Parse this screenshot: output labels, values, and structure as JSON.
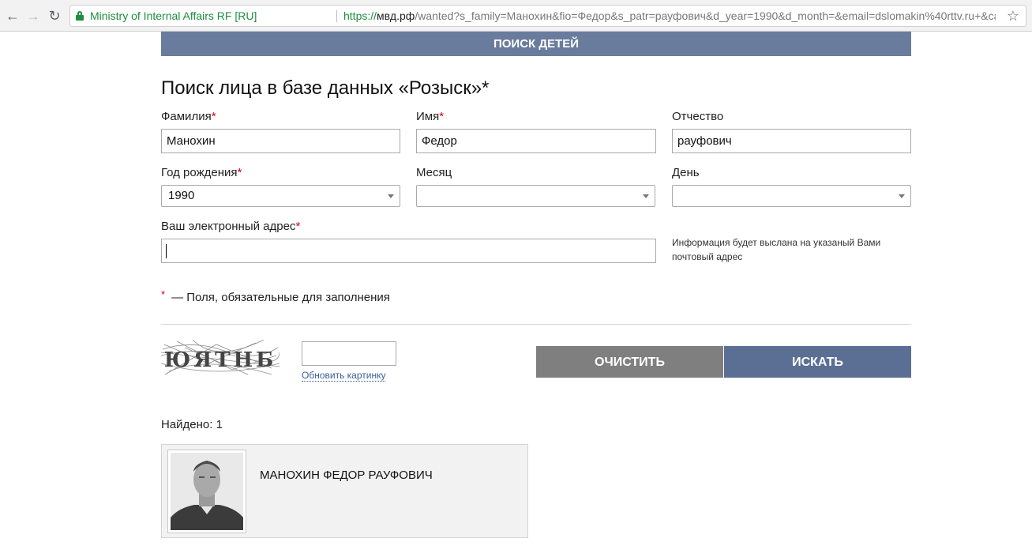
{
  "browser": {
    "site_label": "Ministry of Internal Affairs RF [RU]",
    "url_scheme": "https://",
    "url_host": "мвд.рф",
    "url_path": "/wanted?s_family=Манохин&fio=Федор&s_patr=рауфович&d_year=1990&d_month=&email=dslomakin%40rttv.ru+&captcha..."
  },
  "banner": "ПОИСК ДЕТЕЙ",
  "page_title": "Поиск лица в базе данных «Розыск»*",
  "form": {
    "surname_label": "Фамилия",
    "surname_value": "Манохин",
    "name_label": "Имя",
    "name_value": "Федор",
    "patronymic_label": "Отчество",
    "patronymic_value": "рауфович",
    "year_label": "Год рождения",
    "year_value": "1990",
    "month_label": "Месяц",
    "month_value": "",
    "day_label": "День",
    "day_value": "",
    "email_label": "Ваш электронный адрес",
    "email_value": "",
    "email_hint": "Информация будет выслана на указаный Вами почтовый адрес",
    "required_marker": "*",
    "required_note": "— Поля, обязательные для заполнения"
  },
  "captcha": {
    "text": "ЮЯТНБ",
    "refresh_label": "Обновить картинку"
  },
  "buttons": {
    "clear": "ОЧИСТИТЬ",
    "search": "ИСКАТЬ"
  },
  "results": {
    "found_label": "Найдено: 1",
    "items": [
      {
        "name": "МАНОХИН ФЕДОР РАУФОВИЧ"
      }
    ]
  }
}
